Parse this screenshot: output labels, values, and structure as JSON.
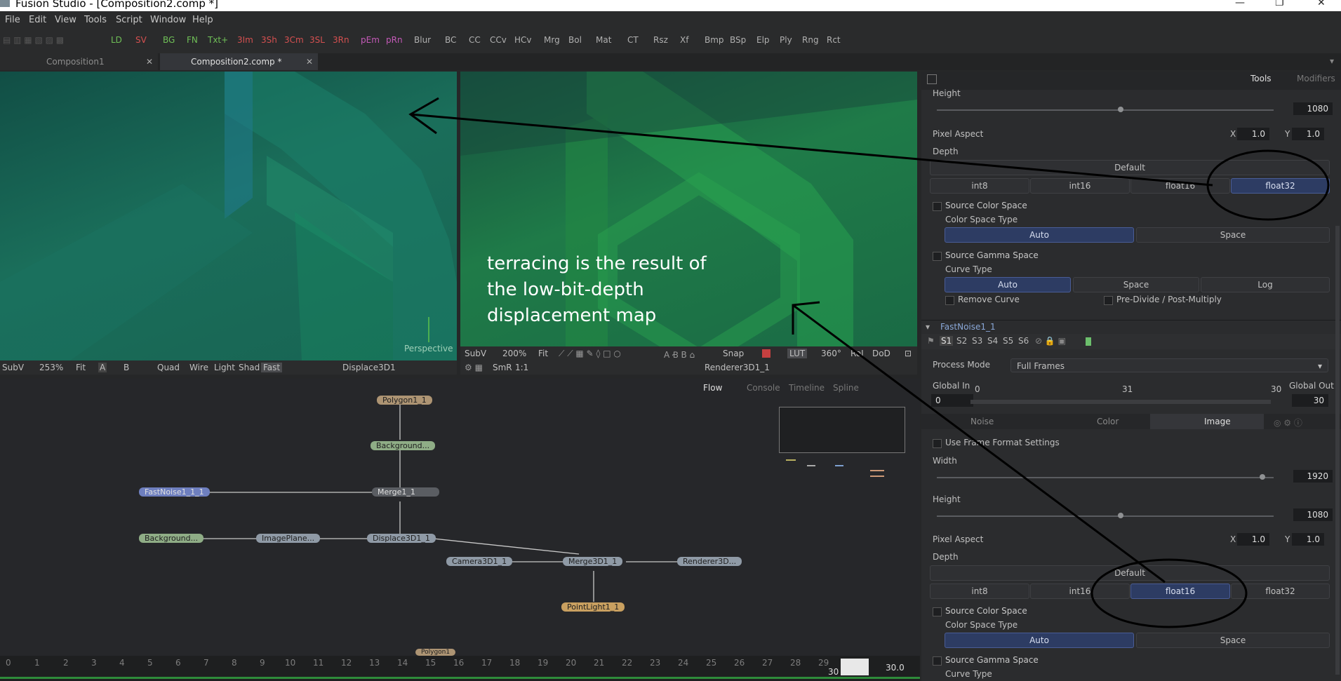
{
  "window": {
    "title": "Fusion Studio - [Composition2.comp *]",
    "controls": [
      "—",
      "❐",
      "✕"
    ]
  },
  "menu": [
    "File",
    "Edit",
    "View",
    "Tools",
    "Script",
    "Window",
    "Help"
  ],
  "toolbar": {
    "tools": [
      "LD",
      "SV",
      "BG",
      "FN",
      "Txt+",
      "3Im",
      "3Sh",
      "3Cm",
      "3SL",
      "3Rn",
      "pEm",
      "pRn",
      "Blur",
      "BC",
      "CC",
      "CCv",
      "HCv",
      "Mrg",
      "Bol",
      "Mat",
      "CT",
      "Rsz",
      "Xf",
      "Bmp",
      "BSp",
      "Elp",
      "Ply",
      "Rng",
      "Rct"
    ]
  },
  "comp_tabs": [
    {
      "label": "Composition1",
      "close": "✕"
    },
    {
      "label": "Composition2.comp *",
      "close": "✕"
    }
  ],
  "viewer_left": {
    "corner_label": "Perspective",
    "bar": {
      "subv": "SubV",
      "zoom": "253%",
      "fit": "Fit",
      "a": "A",
      "b": "B",
      "quad": "Quad",
      "wire": "Wire",
      "light": "Light",
      "shad": "Shad",
      "fast": "Fast",
      "node": "Displace3D1"
    }
  },
  "viewer_right": {
    "bar1": {
      "subv": "SubV",
      "zoom": "200%",
      "fit": "Fit",
      "snap": "Snap",
      "lut": "LUT",
      "deg": "360°",
      "roi": "RoI",
      "dod": "DoD"
    },
    "bar2": {
      "smr": "SmR",
      "ratio": "1:1",
      "node": "Renderer3D1_1"
    }
  },
  "annotation": {
    "line1": "terracing is the result of",
    "line2": "the low-bit-depth",
    "line3": "displacement map"
  },
  "flow_tabs": [
    "Flow",
    "Console",
    "Timeline",
    "Spline"
  ],
  "nodes": [
    "Polygon1_1",
    "Background...",
    "FastNoise1_1_1",
    "Merge1_1",
    "Background...",
    "ImagePlane...",
    "Displace3D1_1",
    "Camera3D1_1",
    "Merge3D1_1",
    "Renderer3D...",
    "PointLight1_1",
    "Polygon1"
  ],
  "timeline": {
    "ticks": [
      "0",
      "1",
      "2",
      "3",
      "4",
      "5",
      "6",
      "7",
      "8",
      "9",
      "10",
      "11",
      "12",
      "13",
      "14",
      "15",
      "16",
      "17",
      "18",
      "19",
      "20",
      "21",
      "22",
      "23",
      "24",
      "25",
      "26",
      "27",
      "28",
      "29"
    ],
    "current": "30",
    "end": "30.0"
  },
  "panel": {
    "tabs": [
      "Tools",
      "Modifiers"
    ],
    "top": {
      "height_label": "Height",
      "height": "1080",
      "pixel_aspect_label": "Pixel Aspect",
      "x_label": "X",
      "x": "1.0",
      "y_label": "Y",
      "y": "1.0",
      "depth_label": "Depth",
      "depth_default": "Default",
      "depth_opts": [
        "int8",
        "int16",
        "float16",
        "float32"
      ],
      "depth_selected": "float32",
      "source_color_space": "Source Color Space",
      "color_space_type": "Color Space Type",
      "cs_auto": "Auto",
      "cs_space": "Space",
      "source_gamma_space": "Source Gamma Space",
      "curve_type": "Curve Type",
      "gamma_opts": [
        "Auto",
        "Space",
        "Log"
      ],
      "remove_curve": "Remove Curve",
      "predivide": "Pre-Divide / Post-Multiply"
    },
    "tool_name": "FastNoise1_1",
    "slots": [
      "S1",
      "S2",
      "S3",
      "S4",
      "S5",
      "S6"
    ],
    "process_mode_label": "Process Mode",
    "process_mode": "Full Frames",
    "global_in_label": "Global In",
    "global_in": "0",
    "global_out_label": "Global Out",
    "global_out": "30",
    "range_start": "0",
    "range_mid": "31",
    "range_end": "30",
    "sub_tabs": [
      "Noise",
      "Color",
      "Image"
    ],
    "bottom": {
      "use_frame_format": "Use Frame Format Settings",
      "width_label": "Width",
      "width": "1920",
      "height_label": "Height",
      "height": "1080",
      "pixel_aspect_label": "Pixel Aspect",
      "x_label": "X",
      "x": "1.0",
      "y_label": "Y",
      "y": "1.0",
      "depth_label": "Depth",
      "depth_default": "Default",
      "depth_opts": [
        "int8",
        "int16",
        "float16",
        "float32"
      ],
      "depth_selected": "float16",
      "source_color_space": "Source Color Space",
      "color_space_type": "Color Space Type",
      "cs_auto": "Auto",
      "cs_space": "Space",
      "source_gamma_space": "Source Gamma Space",
      "curve_type": "Curve Type"
    }
  },
  "colors": {
    "selected_button": "#2d3c63",
    "viewer_green": "#1f7b48",
    "viewer_teal": "#1a6e5a"
  }
}
